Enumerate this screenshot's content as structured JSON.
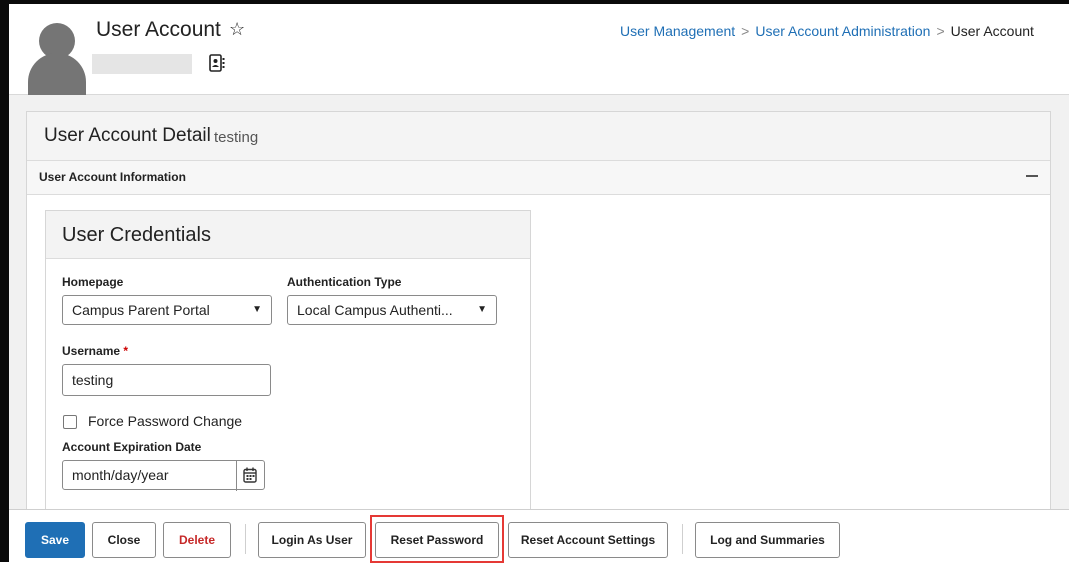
{
  "header": {
    "title": "User Account",
    "favorite_icon": "star-outline-icon",
    "contact_icon": "contact-card-icon",
    "breadcrumb": [
      {
        "label": "User Management"
      },
      {
        "label": "User Account Administration"
      },
      {
        "label": "User Account"
      }
    ],
    "breadcrumb_separator": ">"
  },
  "panel": {
    "title": "User Account Detail",
    "subtitle": "testing"
  },
  "section": {
    "title": "User Account Information",
    "collapse_icon": "collapse-icon"
  },
  "credentials": {
    "title": "User Credentials",
    "homepage": {
      "label": "Homepage",
      "value": "Campus Parent Portal"
    },
    "auth_type": {
      "label": "Authentication Type",
      "value": "Local Campus Authenti..."
    },
    "username": {
      "label": "Username",
      "required_mark": "*",
      "value": "testing"
    },
    "force_password_change": {
      "label": "Force Password Change",
      "checked": false
    },
    "expiration": {
      "label": "Account Expiration Date",
      "placeholder": "month/day/year",
      "icon": "calendar-icon"
    }
  },
  "toolbar": {
    "save": "Save",
    "close": "Close",
    "delete": "Delete",
    "login_as_user": "Login As User",
    "reset_password": "Reset Password",
    "reset_account_settings": "Reset Account Settings",
    "log_and_summaries": "Log and Summaries"
  },
  "colors": {
    "primary": "#1f6fb5",
    "danger": "#c62828",
    "highlight": "#e53935"
  }
}
